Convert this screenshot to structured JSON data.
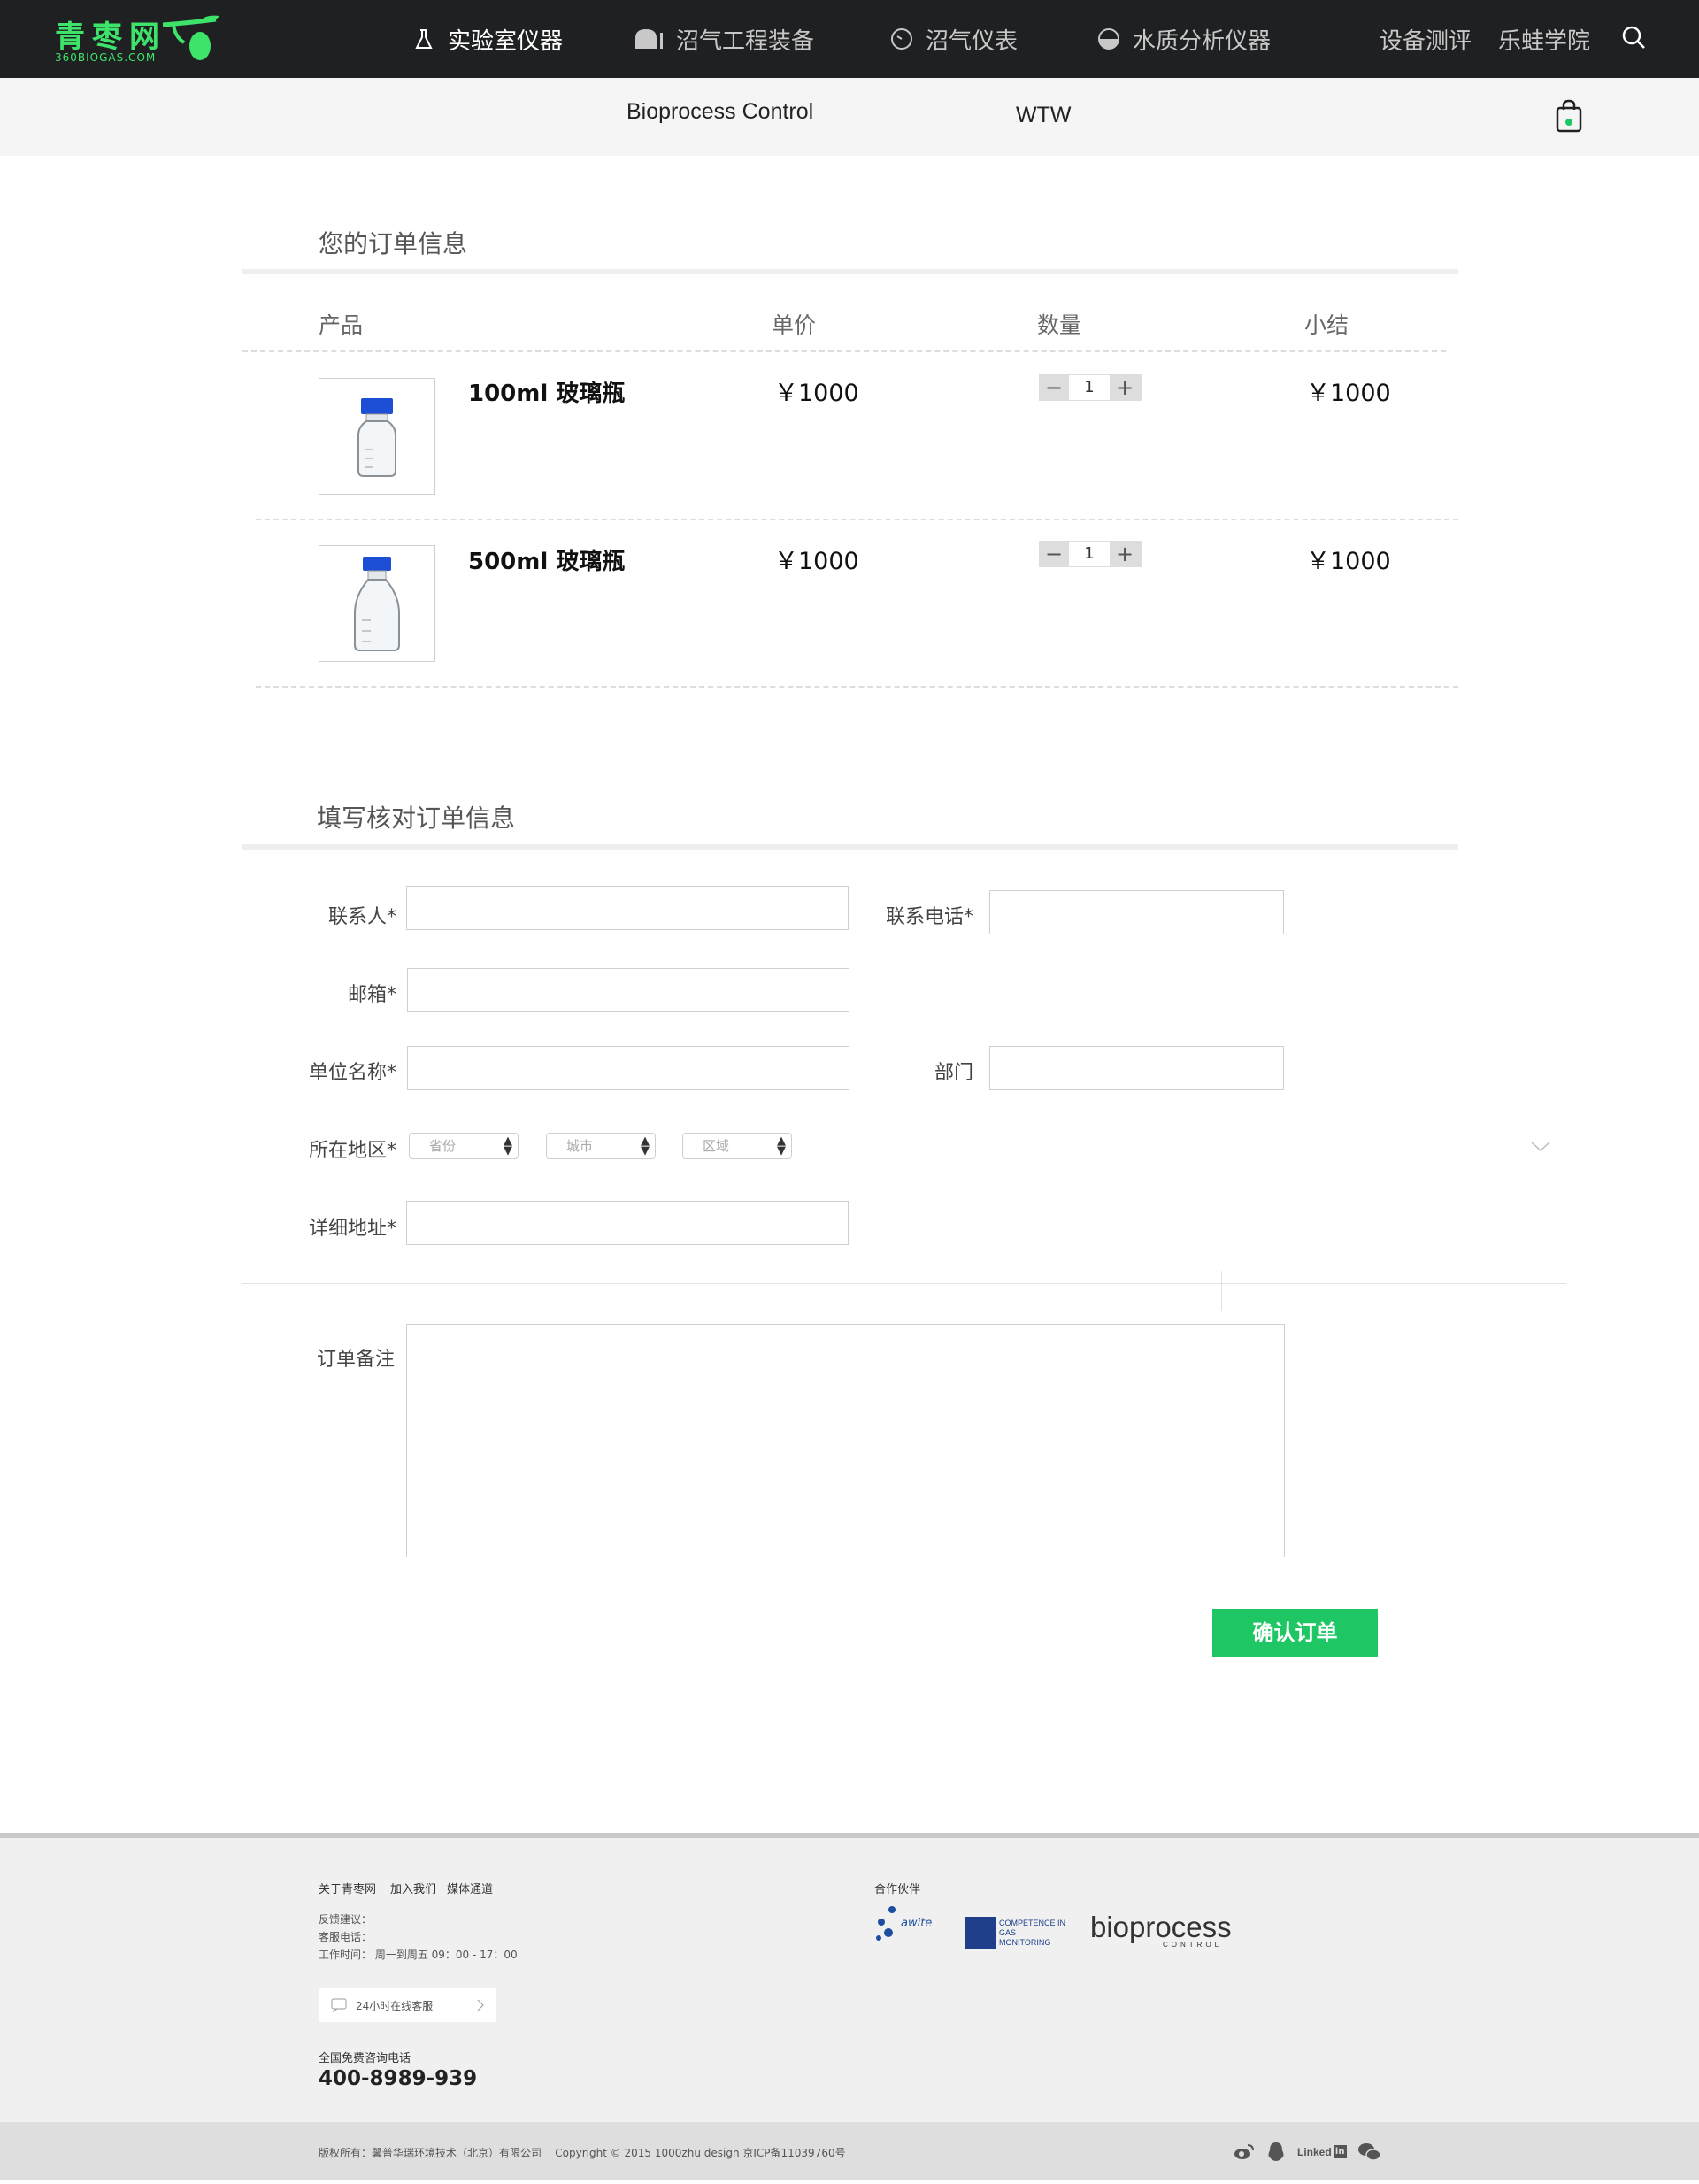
{
  "header": {
    "logo_cn": "青枣网",
    "logo_en": "360BIOGAS.COM",
    "nav": [
      {
        "label": "实验室仪器",
        "icon": "flask-icon"
      },
      {
        "label": "沼气工程装备",
        "icon": "tank-icon"
      },
      {
        "label": "沼气仪表",
        "icon": "gauge-icon"
      },
      {
        "label": "水质分析仪器",
        "icon": "water-icon"
      }
    ],
    "links": [
      "设备测评",
      "乐蛙学院"
    ]
  },
  "subnav": {
    "brands": [
      "Bioprocess Control",
      "WTW"
    ]
  },
  "order": {
    "title": "您的订单信息",
    "columns": [
      "产品",
      "单价",
      "数量",
      "小结"
    ],
    "items": [
      {
        "name": "100ml 玻璃瓶",
        "price": "￥1000",
        "qty": "1",
        "subtotal": "￥1000"
      },
      {
        "name": "500ml 玻璃瓶",
        "price": "￥1000",
        "qty": "1",
        "subtotal": "￥1000"
      }
    ]
  },
  "form": {
    "title": "填写核对订单信息",
    "labels": {
      "contact": "联系人*",
      "phone": "联系电话*",
      "email": "邮箱*",
      "company": "单位名称*",
      "dept": "部门",
      "region": "所在地区*",
      "address": "详细地址*",
      "note": "订单备注"
    },
    "selects": [
      "省份",
      "城市",
      "区域"
    ],
    "submit": "确认订单"
  },
  "footer": {
    "links": [
      "关于青枣网",
      "加入我们",
      "媒体通道"
    ],
    "feedback": "反馈建议：",
    "service_phone": "客服电话：",
    "hours": "工作时间： 周一到周五 09：00 - 17：00",
    "online_service": "24小时在线客服",
    "hotline_label": "全国免费咨询电话",
    "hotline": "400-8989-939",
    "partners_title": "合作伙伴",
    "partners": [
      "awite",
      "COMPETENCE IN GAS MONITORING",
      "bioprocess",
      "CONTROL"
    ],
    "copyright": "版权所有：馨普华瑞环境技术（北京）有限公司    Copyright © 2015 1000zhu design 京ICP备11039760号",
    "social": [
      "weibo-icon",
      "qq-icon",
      "linkedin-icon",
      "wechat-icon"
    ],
    "linkedin_text": "Linked"
  },
  "colors": {
    "brand_green": "#1ec764",
    "nav_bg": "#1f2022",
    "logo_green": "#3ee36a"
  }
}
